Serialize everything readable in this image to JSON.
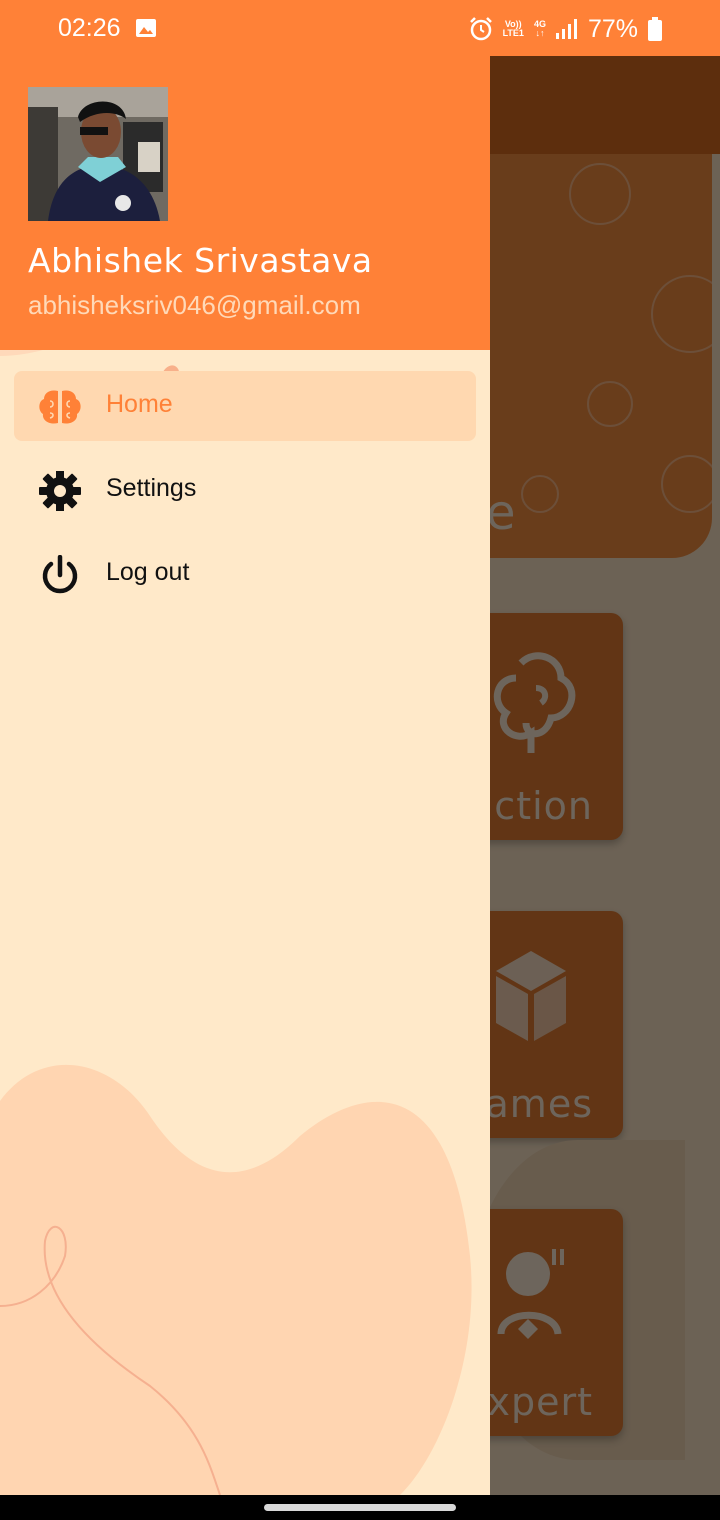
{
  "status_bar": {
    "time": "02:26",
    "network_top": "Vo))",
    "network_bottom": "LTE1",
    "data_type": "4G",
    "battery_percent": "77%",
    "icons": [
      "image-icon",
      "alarm-icon",
      "volte-icon",
      "4g-icon",
      "signal-icon",
      "battery-icon"
    ]
  },
  "drawer": {
    "user": {
      "name": "Abhishek Srivastava",
      "email": "abhisheksriv046@gmail.com"
    },
    "menu": [
      {
        "label": "Home",
        "icon": "brain-icon",
        "active": true
      },
      {
        "label": "Settings",
        "icon": "gear-icon",
        "active": false
      },
      {
        "label": "Log out",
        "icon": "power-icon",
        "active": false
      }
    ]
  },
  "background_app": {
    "banner_text_fragment": "e",
    "cards": [
      {
        "label_fragment": "diction",
        "icon": "brain-icon"
      },
      {
        "label_fragment": "ames",
        "icon": "cube-icon"
      },
      {
        "label_fragment": "xpert",
        "icon": "expert-icon"
      }
    ]
  },
  "colors": {
    "primary": "#ff8137",
    "drawer_background": "#ffe9c9",
    "active_item_background": "#ffd8b0",
    "active_text": "#ff8137"
  }
}
